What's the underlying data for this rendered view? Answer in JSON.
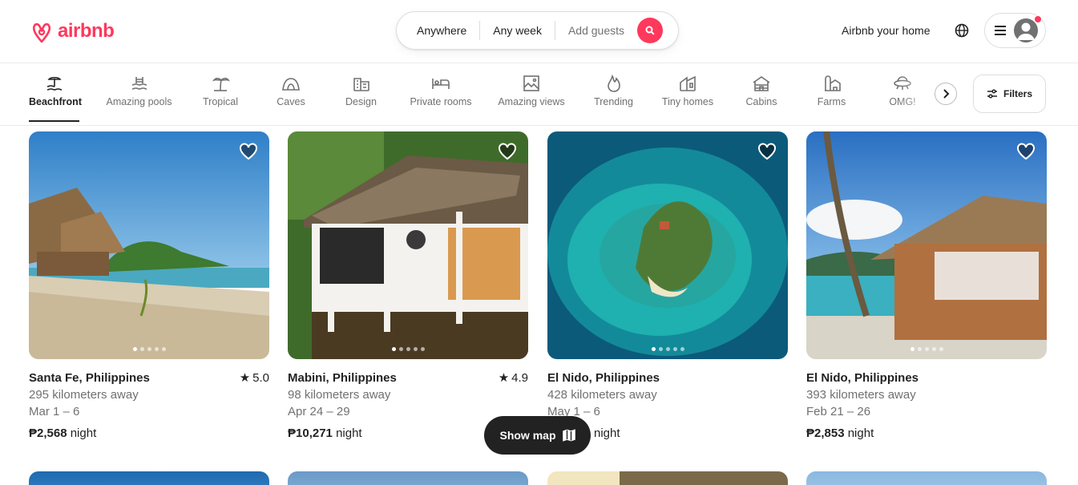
{
  "brand": {
    "name": "airbnb",
    "color": "#ff385c"
  },
  "search": {
    "where": "Anywhere",
    "when": "Any week",
    "who": "Add guests"
  },
  "header": {
    "host_link": "Airbnb your home",
    "globe_icon": "globe-icon",
    "menu_icon": "hamburger-icon"
  },
  "categories": [
    {
      "label": "Beachfront",
      "icon": "beachfront-icon",
      "active": true
    },
    {
      "label": "Amazing pools",
      "icon": "pool-icon"
    },
    {
      "label": "Tropical",
      "icon": "palm-icon"
    },
    {
      "label": "Caves",
      "icon": "cave-icon"
    },
    {
      "label": "Design",
      "icon": "design-icon"
    },
    {
      "label": "Private rooms",
      "icon": "bed-icon"
    },
    {
      "label": "Amazing views",
      "icon": "views-icon"
    },
    {
      "label": "Trending",
      "icon": "flame-icon"
    },
    {
      "label": "Tiny homes",
      "icon": "tiny-home-icon"
    },
    {
      "label": "Cabins",
      "icon": "cabin-icon"
    },
    {
      "label": "Farms",
      "icon": "farm-icon"
    },
    {
      "label": "OMG!",
      "icon": "ufo-icon"
    }
  ],
  "filters": {
    "label": "Filters"
  },
  "listings": [
    {
      "location": "Santa Fe, Philippines",
      "rating": "5.0",
      "distance": "295 kilometers away",
      "dates": "Mar 1 – 6",
      "price": "₱2,568",
      "unit": "night"
    },
    {
      "location": "Mabini, Philippines",
      "rating": "4.9",
      "distance": "98 kilometers away",
      "dates": "Apr 24 – 29",
      "price": "₱10,271",
      "unit": "night"
    },
    {
      "location": "El Nido, Philippines",
      "rating": "",
      "distance": "428 kilometers away",
      "dates": "May 1 – 6",
      "price": "",
      "unit": "night"
    },
    {
      "location": "El Nido, Philippines",
      "rating": "",
      "distance": "393 kilometers away",
      "dates": "Feb 21 – 26",
      "price": "₱2,853",
      "unit": "night"
    }
  ],
  "show_map": {
    "label": "Show map"
  }
}
